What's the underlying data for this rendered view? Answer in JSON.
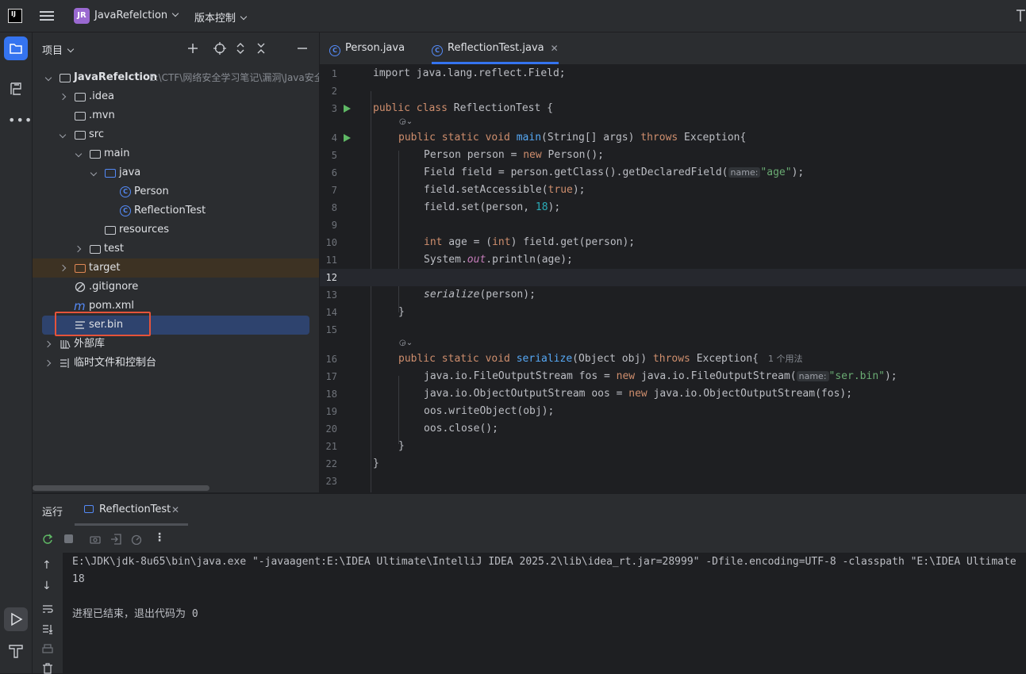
{
  "titlebar": {
    "badge": "JR",
    "project_name": "JavaRefelction",
    "vcs": "版本控制"
  },
  "project_panel": {
    "title": "项目",
    "tree": [
      {
        "label": "JavaRefelction",
        "path": "E:\\CTF\\网络安全学习笔记\\漏洞\\Java安全"
      },
      {
        "label": ".idea"
      },
      {
        "label": ".mvn"
      },
      {
        "label": "src"
      },
      {
        "label": "main"
      },
      {
        "label": "java"
      },
      {
        "label": "Person"
      },
      {
        "label": "ReflectionTest"
      },
      {
        "label": "resources"
      },
      {
        "label": "test"
      },
      {
        "label": "target"
      },
      {
        "label": ".gitignore"
      },
      {
        "label": "pom.xml"
      },
      {
        "label": "ser.bin"
      },
      {
        "label": "外部库"
      },
      {
        "label": "临时文件和控制台"
      }
    ]
  },
  "editor": {
    "tabs": [
      {
        "label": "Person.java"
      },
      {
        "label": "ReflectionTest.java"
      }
    ],
    "current_line": 12,
    "lines": {
      "l1": "import java.lang.reflect.Field;",
      "l3a": "public class ",
      "l3b": "ReflectionTest {",
      "l4a": "public static void ",
      "l4b": "main",
      "l4c": "(String[] args) ",
      "l4d": "throws",
      "l4e": " Exception{",
      "l5a": "Person person = ",
      "l5b": "new",
      "l5c": " Person();",
      "l6a": "Field field = person.getClass().getDeclaredField(",
      "l6hint": "name:",
      "l6str": "\"age\"",
      "l6end": ");",
      "l7a": "field.setAccessible(",
      "l7b": "true",
      "l7c": ");",
      "l8a": "field.set(person, ",
      "l8b": "18",
      "l8c": ");",
      "l10a": "int",
      "l10b": " age = (",
      "l10c": "int",
      "l10d": ") field.get(person);",
      "l11a": "System.",
      "l11b": "out",
      "l11c": ".println(age);",
      "l13a": "serialize",
      "l13b": "(person);",
      "l14": "}",
      "l16a": "public static void ",
      "l16b": "serialize",
      "l16c": "(Object obj) ",
      "l16d": "throws",
      "l16e": " Exception{",
      "l16usage": "1 个用法",
      "l17a": "java.io.FileOutputStream fos = ",
      "l17b": "new",
      "l17c": " java.io.FileOutputStream(",
      "l17hint": "name:",
      "l17str": "\"ser.bin\"",
      "l17end": ");",
      "l18a": "java.io.ObjectOutputStream oos = ",
      "l18b": "new",
      "l18c": " java.io.ObjectOutputStream(fos);",
      "l19": "oos.writeObject(obj);",
      "l20": "oos.close();",
      "l21": "}",
      "l22": "}"
    },
    "line_numbers": [
      "1",
      "2",
      "3",
      "4",
      "5",
      "6",
      "7",
      "8",
      "9",
      "10",
      "11",
      "12",
      "13",
      "14",
      "15",
      "16",
      "17",
      "18",
      "19",
      "20",
      "21",
      "22",
      "23"
    ]
  },
  "run_panel": {
    "title": "运行",
    "tab": "ReflectionTest",
    "console": [
      "E:\\JDK\\jdk-8u65\\bin\\java.exe \"-javaagent:E:\\IDEA Ultimate\\IntelliJ IDEA 2025.2\\lib\\idea_rt.jar=28999\" -Dfile.encoding=UTF-8 -classpath \"E:\\IDEA Ultimate",
      "18",
      "",
      "进程已结束，退出代码为 0"
    ]
  },
  "colors": {
    "accent": "#3574f0",
    "keyword": "#cf8e6d",
    "function": "#56a8f5",
    "string": "#6aab73",
    "number": "#2aacb8",
    "highlight_box": "#e5533a"
  }
}
